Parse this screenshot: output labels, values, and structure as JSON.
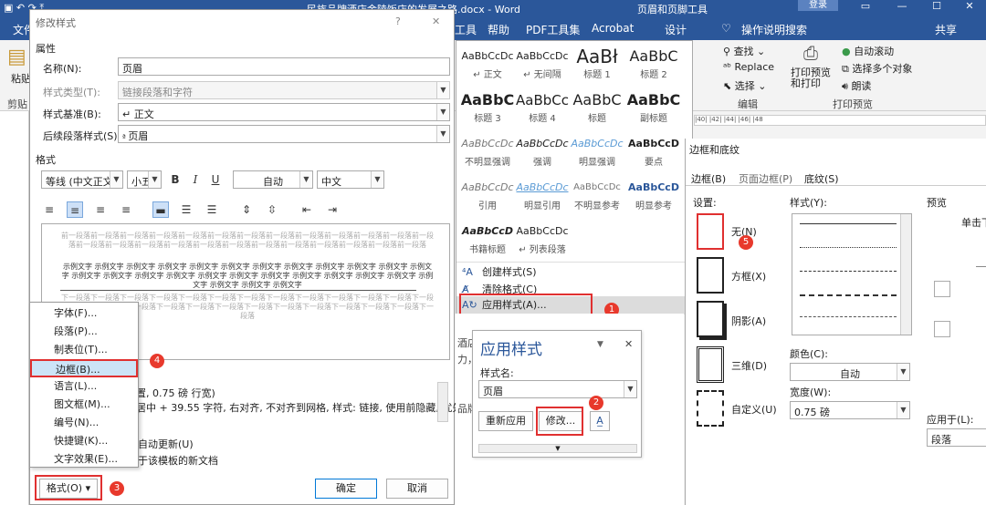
{
  "app": {
    "doc_title": "民族品牌酒店金陵饭店的发展之路.docx - Word",
    "context_title": "页眉和页脚工具",
    "login_label": "登录",
    "share_label": "共享",
    "tell_me": "操作说明搜索",
    "tabs": [
      "文件",
      "工具",
      "帮助",
      "PDF工具集",
      "Acrobat",
      "设计"
    ]
  },
  "ribbon": {
    "paste": "粘贴",
    "clipboard": "剪贴",
    "find": "查找",
    "replace": "Replace",
    "select": "选择",
    "edit_group": "编辑",
    "print_preview": "打印预览和打印",
    "auto_scroll": "自动滚动",
    "select_multi": "选择多个对象",
    "read_aloud": "朗读",
    "print_group": "打印预览",
    "ruler_marks": "|40| |42| |44| |46| |48"
  },
  "modify_dialog": {
    "title": "修改样式",
    "help": "?",
    "close": "✕",
    "section_props": "属性",
    "name_label": "名称(N):",
    "name_value": "页眉",
    "type_label": "样式类型(T):",
    "type_value": "链接段落和字符",
    "based_label": "样式基准(B):",
    "based_value": "↵ 正文",
    "next_label": "后续段落样式(S):",
    "next_value": "页眉",
    "section_format": "格式",
    "font": "等线 (中文正文)",
    "size": "小五",
    "bold": "B",
    "italic": "I",
    "underline": "U",
    "color": "自动",
    "lang": "中文",
    "prev_para": "前一段落前一段落前一段落前一段落前一段落前一段落前一段落前一段落前一段落前一段落前一段落前一段落前一段落前一段落前一段落前一段落前一段落前一段落前一段落前一段落前一段落前一段落前一段落前一段落前一段落",
    "sample_text": "示例文字 示例文字 示例文字 示例文字 示例文字 示例文字 示例文字 示例文字 示例文字 示例文字 示例文字 示例文字 示例文字 示例文字 示例文字 示例文字 示例文字 示例文字 示例文字 示例文字 示例文字 示例文字 示例文字 示例文字 示例文字 示例文字 示例文字",
    "next_para": "下一段落下一段落下一段落下一段落下一段落下一段落下一段落下一段落下一段落下一段落下一段落下一段落下一段落下一段落下一段落下一段落下一段落下一段落下一段落下一段落下一段落下一段落下一段落下一段落下一段落下一段落",
    "desc_line1": "置, 0.75 磅 行宽)",
    "desc_line2": "居中 + 39.55 字符, 右对齐, 不对齐到网格, 样式: 链接, 使用前隐藏, 优先",
    "auto_update": "自动更新(U)",
    "new_docs": "于该模板的新文档",
    "format_btn": "格式(O) ▾",
    "ok": "确定",
    "cancel": "取消"
  },
  "format_menu": {
    "items": [
      "字体(F)...",
      "段落(P)...",
      "制表位(T)...",
      "边框(B)...",
      "语言(L)...",
      "图文框(M)...",
      "编号(N)...",
      "快捷键(K)...",
      "文字效果(E)..."
    ]
  },
  "gallery": {
    "styles": [
      {
        "sample": "AaBbCcDc",
        "name": "↵ 正文"
      },
      {
        "sample": "AaBbCcDc",
        "name": "↵ 无间隔"
      },
      {
        "sample": "AaBł",
        "name": "标题 1"
      },
      {
        "sample": "AaBbC",
        "name": "标题 2"
      },
      {
        "sample": "AaBbC",
        "name": "标题 3"
      },
      {
        "sample": "AaBbCc",
        "name": "标题 4"
      },
      {
        "sample": "AaBbC",
        "name": "标题"
      },
      {
        "sample": "AaBbC",
        "name": "副标题"
      },
      {
        "sample": "AaBbCcDc",
        "name": "不明显强调"
      },
      {
        "sample": "AaBbCcDc",
        "name": "强调"
      },
      {
        "sample": "AaBbCcDc",
        "name": "明显强调"
      },
      {
        "sample": "AaBbCcD",
        "name": "要点"
      },
      {
        "sample": "AaBbCcDc",
        "name": "引用"
      },
      {
        "sample": "AaBbCcDc",
        "name": "明显引用"
      },
      {
        "sample": "AaBbCcDc",
        "name": "不明显参考"
      },
      {
        "sample": "AaBbCcD",
        "name": "明显参考"
      },
      {
        "sample": "AaBbCcD",
        "name": "书籍标题"
      },
      {
        "sample": "AaBbCcDc",
        "name": "↵ 列表段落"
      }
    ],
    "create": "创建样式(S)",
    "clear": "清除格式(C)",
    "apply": "应用样式(A)..."
  },
  "doc_text": {
    "line1": "酒店 ... 新形势下",
    "line2": "力，... 一席之地",
    "line3": "品牌..."
  },
  "apply_dialog": {
    "title": "应用样式",
    "name_label": "样式名:",
    "name_value": "页眉",
    "reapply": "重新应用",
    "modify": "修改...",
    "close": "✕"
  },
  "border_dialog": {
    "title": "边框和底纹",
    "tabs": [
      "边框(B)",
      "页面边框(P)",
      "底纹(S)"
    ],
    "setting_label": "设置:",
    "settings": [
      "无(N)",
      "方框(X)",
      "阴影(A)",
      "三维(D)",
      "自定义(U)"
    ],
    "style_label": "样式(Y):",
    "color_label": "颜色(C):",
    "color_value": "自动",
    "width_label": "宽度(W):",
    "width_value": "0.75 磅",
    "preview_label": "预览",
    "preview_hint": "单击下",
    "apply_to_label": "应用于(L):",
    "apply_to_value": "段落"
  },
  "badges": [
    "1",
    "2",
    "3",
    "4",
    "5"
  ],
  "colors": {
    "brand": "#2b579a",
    "highlight": "#e03030",
    "badge": "#e8392c",
    "selection": "#cce4f7"
  }
}
